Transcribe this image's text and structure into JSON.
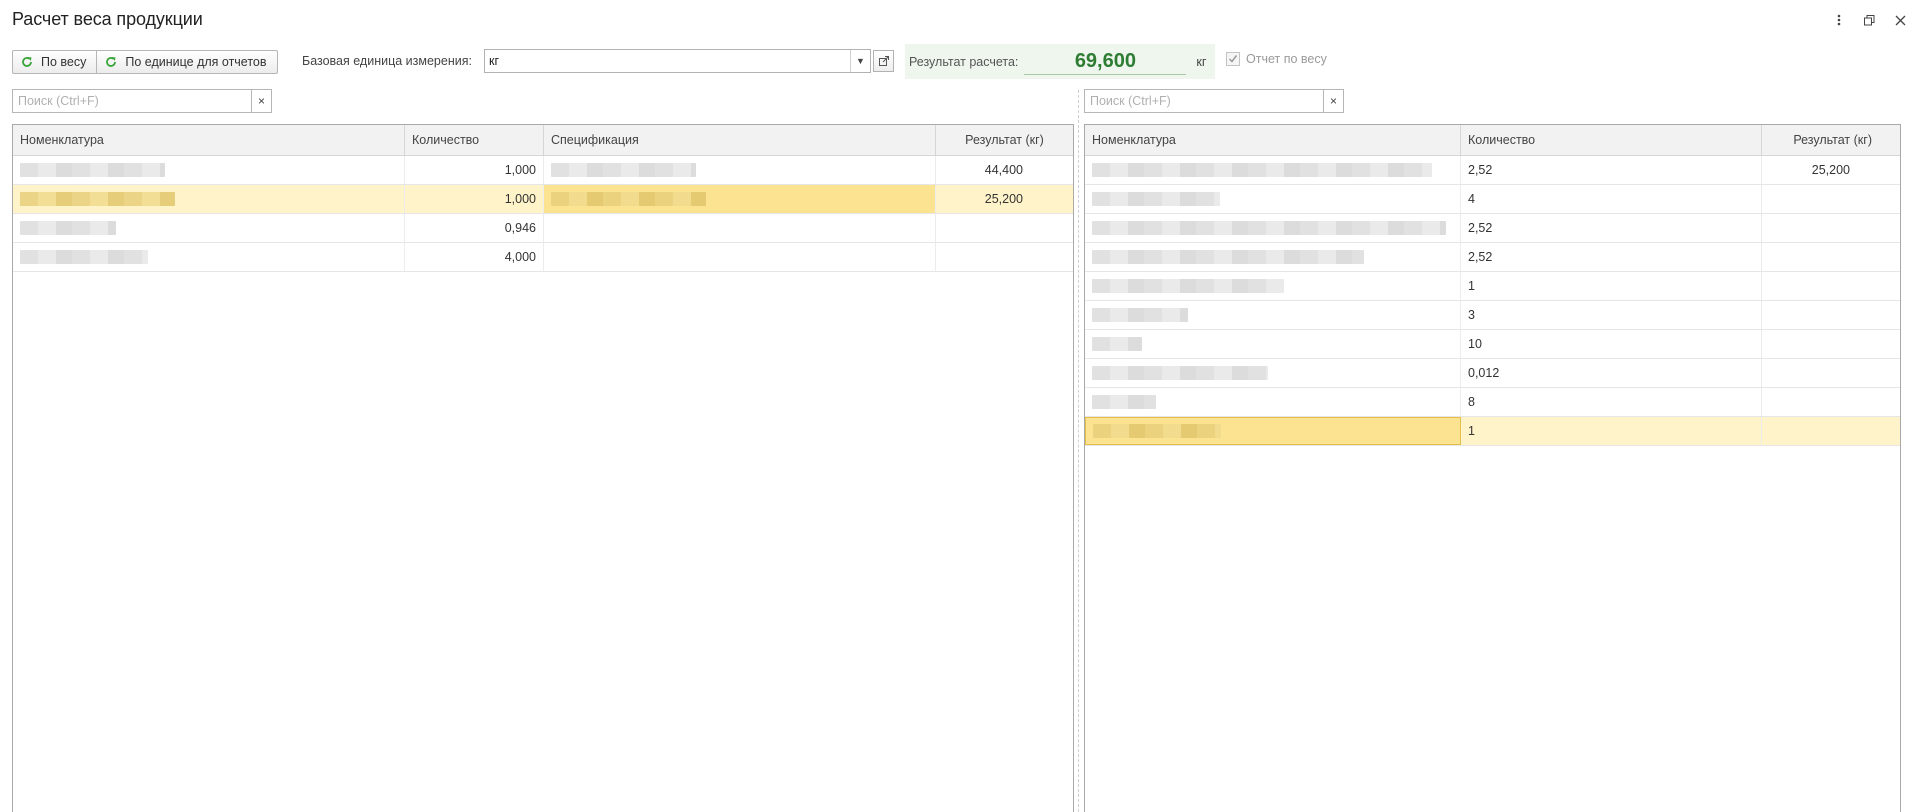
{
  "window": {
    "title": "Расчет веса продукции",
    "controls": [
      "more-icon",
      "restore-icon",
      "close-icon"
    ]
  },
  "toolbar": {
    "by_weight_label": "По весу",
    "by_report_unit_label": "По единице для отчетов",
    "base_unit_label": "Базовая единица измерения:",
    "base_unit_value": "кг",
    "result_label": "Результат расчета:",
    "result_value": "69,600",
    "result_unit": "кг",
    "report_by_weight_label": "Отчет по весу",
    "report_by_weight_checked": true
  },
  "search_left": {
    "placeholder": "Поиск (Ctrl+F)",
    "clear": "×"
  },
  "search_right": {
    "placeholder": "Поиск (Ctrl+F)",
    "clear": "×"
  },
  "left_table": {
    "headers": [
      "Номенклатура",
      "Количество",
      "Спецификация",
      "Результат (кг)"
    ],
    "rows": [
      {
        "name": "",
        "qty": "1,000",
        "spec": "",
        "result": "44,400"
      },
      {
        "name": "",
        "qty": "1,000",
        "spec": "",
        "result": "25,200"
      },
      {
        "name": "",
        "qty": "0,946",
        "spec": "",
        "result": ""
      },
      {
        "name": "",
        "qty": "4,000",
        "spec": "",
        "result": ""
      }
    ]
  },
  "right_table": {
    "headers": [
      "Номенклатура",
      "Количество",
      "Результат (кг)"
    ],
    "rows": [
      {
        "name": "",
        "qty": "2,52",
        "result": "25,200"
      },
      {
        "name": "",
        "qty": "4",
        "result": ""
      },
      {
        "name": "",
        "qty": "2,52",
        "result": ""
      },
      {
        "name": "",
        "qty": "2,52",
        "result": ""
      },
      {
        "name": "",
        "qty": "1",
        "result": ""
      },
      {
        "name": "",
        "qty": "3",
        "result": ""
      },
      {
        "name": "",
        "qty": "10",
        "result": ""
      },
      {
        "name": "",
        "qty": "0,012",
        "result": ""
      },
      {
        "name": "",
        "qty": "8",
        "result": ""
      },
      {
        "name": "",
        "qty": "1",
        "result": ""
      }
    ]
  },
  "colors": {
    "result_text": "#2e7d32",
    "result_bg": "#eef6ee",
    "selected_row": "#fff3c9",
    "selected_cell": "#fbe391",
    "refresh_icon": "#3aa53a"
  }
}
